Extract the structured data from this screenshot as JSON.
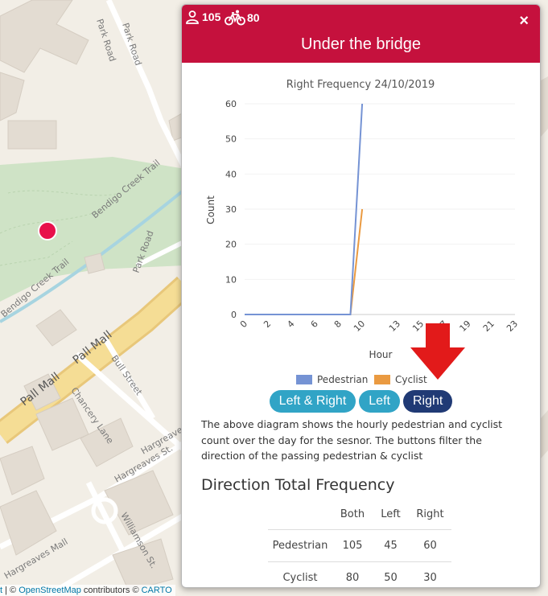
{
  "map": {
    "streets": [
      "Park Road",
      "Park Road",
      "Park Road",
      "Bendigo Creek Trail",
      "Bendigo Creek Trail",
      "Pall Mall",
      "Pall Mall",
      "Bull Street",
      "Chancery Lane",
      "Hargreaves St.",
      "Hargreaves St.",
      "Hargreaves Mall",
      "Williamson St."
    ],
    "attribution": {
      "lead": "t",
      "separator": " | © ",
      "osm_link": "OpenStreetMap",
      "middle": " contributors © ",
      "carto_link": "CARTO"
    },
    "marker_color": "#e8114b"
  },
  "popup": {
    "pedestrian_count": "105",
    "cyclist_count": "80",
    "title": "Under the bridge",
    "close_label": "×",
    "header_color": "#c5113d",
    "filter_buttons": [
      {
        "label": "Left & Right",
        "active": false
      },
      {
        "label": "Left",
        "active": false
      },
      {
        "label": "Right",
        "active": true
      }
    ],
    "description": "The above diagram shows the hourly pedestrian and cyclist count over the day for the sesnor. The buttons filter the direction of the passing pedestrian & cyclist",
    "table_heading": "Direction Total Frequency",
    "table": {
      "columns": [
        "",
        "Both",
        "Left",
        "Right"
      ],
      "rows": [
        [
          "Pedestrian",
          "105",
          "45",
          "60"
        ],
        [
          "Cyclist",
          "80",
          "50",
          "30"
        ]
      ]
    }
  },
  "chart_data": {
    "type": "line",
    "title": "Right Frequency 24/10/2019",
    "xlabel": "Hour",
    "ylabel": "Count",
    "x": [
      0,
      1,
      2,
      3,
      4,
      5,
      6,
      7,
      8,
      9,
      10
    ],
    "xticks": [
      0,
      2,
      4,
      6,
      8,
      10,
      13,
      15,
      17,
      19,
      21,
      23
    ],
    "yticks": [
      0,
      10,
      20,
      30,
      40,
      50,
      60
    ],
    "ylim": [
      0,
      60
    ],
    "series": [
      {
        "name": "Pedestrian",
        "color": "#7593d4",
        "values": [
          0,
          0,
          0,
          0,
          0,
          0,
          0,
          0,
          0,
          0,
          60
        ]
      },
      {
        "name": "Cyclist",
        "color": "#ea9a41",
        "values": [
          0,
          0,
          0,
          0,
          0,
          0,
          0,
          0,
          0,
          0,
          30
        ]
      }
    ],
    "legend_position": "bottom",
    "annotation_arrow_color": "#e21a1a"
  }
}
